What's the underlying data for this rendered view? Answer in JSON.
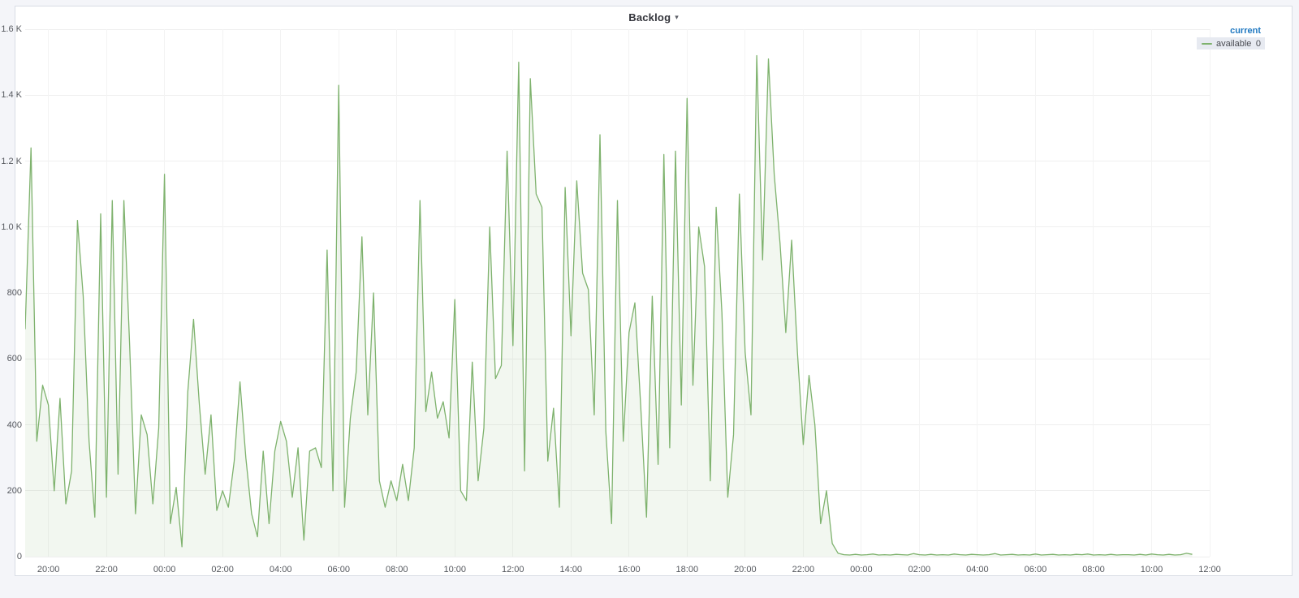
{
  "panel": {
    "title": "Backlog",
    "caret": "▾"
  },
  "legend": {
    "header": "current",
    "series": [
      {
        "label": "available",
        "current": "0",
        "color": "#7eb26d"
      }
    ]
  },
  "chart_data": {
    "type": "area",
    "title": "Backlog",
    "legend_position": "right-top",
    "grid": true,
    "series": [
      {
        "name": "available",
        "line_color": "#7eb26d",
        "fill_color": "rgba(126,178,109,0.1)",
        "points": {
          "start_hour": 19.2,
          "step_hours": 0.2,
          "values": [
            690,
            1240,
            350,
            520,
            460,
            200,
            480,
            160,
            260,
            1020,
            790,
            350,
            120,
            1040,
            180,
            1080,
            250,
            1080,
            640,
            130,
            430,
            370,
            160,
            390,
            1160,
            100,
            210,
            30,
            500,
            720,
            460,
            250,
            430,
            140,
            200,
            150,
            290,
            530,
            300,
            130,
            60,
            320,
            100,
            320,
            410,
            350,
            180,
            330,
            50,
            320,
            330,
            270,
            930,
            200,
            1430,
            150,
            420,
            560,
            970,
            430,
            800,
            230,
            150,
            230,
            170,
            280,
            170,
            330,
            1080,
            440,
            560,
            420,
            470,
            360,
            780,
            200,
            170,
            590,
            230,
            390,
            1000,
            540,
            580,
            1230,
            640,
            1500,
            260,
            1450,
            1100,
            1060,
            290,
            450,
            150,
            1120,
            670,
            1140,
            860,
            810,
            430,
            1280,
            380,
            100,
            1080,
            350,
            680,
            770,
            460,
            120,
            790,
            280,
            1220,
            330,
            1230,
            460,
            1390,
            520,
            1000,
            880,
            230,
            1060,
            740,
            180,
            370,
            1100,
            620,
            430,
            1520,
            900,
            1510,
            1160,
            950,
            680,
            960,
            620,
            340,
            550,
            400,
            100,
            200,
            40,
            10,
            6,
            5,
            7,
            5,
            6,
            8,
            5,
            6,
            5,
            7,
            6,
            5,
            9,
            6,
            5,
            7,
            5,
            6,
            5,
            8,
            6,
            5,
            7,
            6,
            5,
            6,
            9,
            5,
            6,
            7,
            5,
            6,
            5,
            8,
            5,
            6,
            7,
            5,
            6,
            5,
            7,
            6,
            8,
            5,
            6,
            5,
            7,
            5,
            6,
            6,
            5,
            7,
            5,
            8,
            6,
            5,
            7,
            5,
            6,
            10,
            7
          ]
        }
      }
    ],
    "x_axis": {
      "start_hour": 19.2,
      "end_hour": 60.0,
      "tick_hours": [
        20,
        22,
        24,
        26,
        28,
        30,
        32,
        34,
        36,
        38,
        40,
        42,
        44,
        46,
        48,
        50,
        52,
        54,
        56,
        58,
        60
      ],
      "tick_labels": [
        "20:00",
        "22:00",
        "00:00",
        "02:00",
        "04:00",
        "06:00",
        "08:00",
        "10:00",
        "12:00",
        "14:00",
        "16:00",
        "18:00",
        "20:00",
        "22:00",
        "00:00",
        "02:00",
        "04:00",
        "06:00",
        "08:00",
        "10:00",
        "12:00"
      ]
    },
    "y_axis": {
      "min": 0,
      "max": 1600,
      "tick_values": [
        0,
        200,
        400,
        600,
        800,
        1000,
        1200,
        1400,
        1600
      ],
      "tick_labels": [
        "0",
        "200",
        "400",
        "600",
        "800",
        "1.0 K",
        "1.2 K",
        "1.4 K",
        "1.6 K"
      ]
    }
  }
}
